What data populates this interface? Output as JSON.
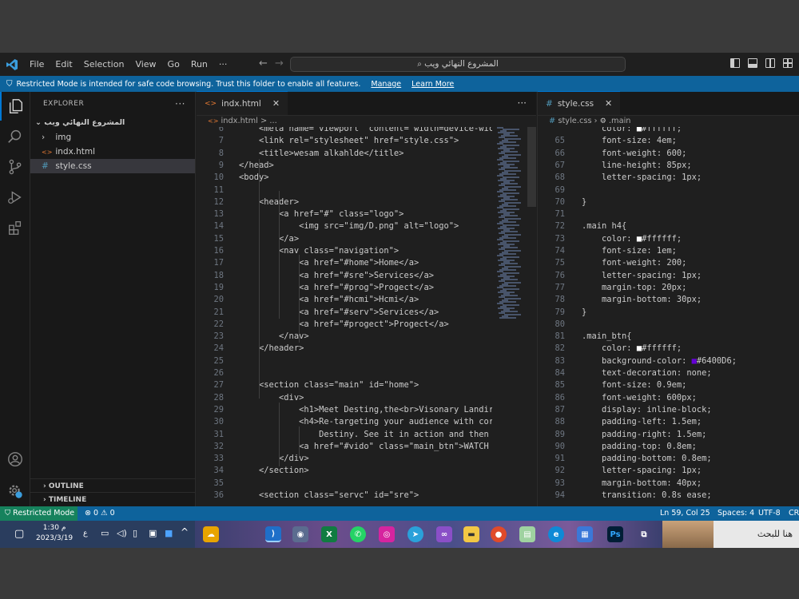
{
  "titlebar": {
    "menu": [
      "File",
      "Edit",
      "Selection",
      "View",
      "Go",
      "Run",
      "···"
    ],
    "search_text": "المشروع النهائي ويب",
    "icons": [
      "vscode-logo",
      "back-arrow",
      "forward-arrow",
      "toggle-sidebar",
      "toggle-panel",
      "toggle-secondary",
      "customize-layout"
    ]
  },
  "restricted_bar": {
    "message": "Restricted Mode is intended for safe code browsing. Trust this folder to enable all features.",
    "manage": "Manage",
    "learn_more": "Learn More"
  },
  "sidebar": {
    "title": "EXPLORER",
    "more": "···",
    "folder": "المشروع النهائي ويب",
    "items": [
      {
        "label": "img",
        "icon": ">"
      },
      {
        "label": "indx.html",
        "icon": "<>"
      },
      {
        "label": "style.css",
        "icon": "#"
      }
    ],
    "outline": "OUTLINE",
    "timeline": "TIMELINE"
  },
  "editor_left": {
    "tab_label": "indx.html",
    "tab_icon": "<>",
    "breadcrumb_file": "indx.html",
    "breadcrumb_rest": "> ...",
    "more": "···",
    "lines": [
      {
        "n": "6",
        "t": "    <meta name=\"viewport\" content=\"width=device-wic"
      },
      {
        "n": "7",
        "t": "    <link rel=\"stylesheet\" href=\"style.css\">"
      },
      {
        "n": "8",
        "t": "    <title>wesam alkahlde</title>"
      },
      {
        "n": "9",
        "t": "</head>"
      },
      {
        "n": "10",
        "t": "<body>"
      },
      {
        "n": "11",
        "t": ""
      },
      {
        "n": "12",
        "t": "    <header>"
      },
      {
        "n": "13",
        "t": "        <a href=\"#\" class=\"logo\">"
      },
      {
        "n": "14",
        "t": "            <img src=\"img/D.png\" alt=\"logo\">"
      },
      {
        "n": "15",
        "t": "        </a>"
      },
      {
        "n": "16",
        "t": "        <nav class=\"navigation\">"
      },
      {
        "n": "17",
        "t": "            <a href=\"#home\">Home</a>"
      },
      {
        "n": "18",
        "t": "            <a href=\"#sre\">Services</a>"
      },
      {
        "n": "19",
        "t": "            <a href=\"#prog\">Progect</a>"
      },
      {
        "n": "20",
        "t": "            <a href=\"#hcmi\">Hcmi</a>"
      },
      {
        "n": "21",
        "t": "            <a href=\"#serv\">Services</a>"
      },
      {
        "n": "22",
        "t": "            <a href=\"#progect\">Progect</a>"
      },
      {
        "n": "23",
        "t": "        </nav>"
      },
      {
        "n": "24",
        "t": "    </header>"
      },
      {
        "n": "25",
        "t": ""
      },
      {
        "n": "26",
        "t": ""
      },
      {
        "n": "27",
        "t": "    <section class=\"main\" id=\"home\">"
      },
      {
        "n": "28",
        "t": "        <div>"
      },
      {
        "n": "29",
        "t": "            <h1>Meet Desting,the<br>Visonary Landir"
      },
      {
        "n": "30",
        "t": "            <h4>Re-targeting your audience with cor"
      },
      {
        "n": "31",
        "t": "                Destiny. See it in action and then"
      },
      {
        "n": "32",
        "t": "            <a href=\"#vido\" class=\"main_btn\">WATCH"
      },
      {
        "n": "33",
        "t": "        </div>"
      },
      {
        "n": "34",
        "t": "    </section>"
      },
      {
        "n": "35",
        "t": ""
      },
      {
        "n": "36",
        "t": "    <section class=\"servc\" id=\"sre\">"
      }
    ]
  },
  "editor_right": {
    "tab_label": "style.css",
    "tab_icon": "#",
    "tab_close": "✕",
    "breadcrumb_file": "style.css",
    "breadcrumb_sym": ".main",
    "lines": [
      {
        "n": "",
        "t": "    color: ■#ffffff;"
      },
      {
        "n": "65",
        "t": "    font-size: 4em;"
      },
      {
        "n": "66",
        "t": "    font-weight: 600;"
      },
      {
        "n": "67",
        "t": "    line-height: 85px;"
      },
      {
        "n": "68",
        "t": "    letter-spacing: 1px;"
      },
      {
        "n": "69",
        "t": ""
      },
      {
        "n": "70",
        "t": "}"
      },
      {
        "n": "71",
        "t": ""
      },
      {
        "n": "72",
        "t": ".main h4{"
      },
      {
        "n": "73",
        "t": "    color: ■#ffffff;"
      },
      {
        "n": "74",
        "t": "    font-size: 1em;"
      },
      {
        "n": "75",
        "t": "    font-weight: 200;"
      },
      {
        "n": "76",
        "t": "    letter-spacing: 1px;"
      },
      {
        "n": "77",
        "t": "    margin-top: 20px;"
      },
      {
        "n": "78",
        "t": "    margin-bottom: 30px;"
      },
      {
        "n": "79",
        "t": "}"
      },
      {
        "n": "80",
        "t": ""
      },
      {
        "n": "81",
        "t": ".main_btn{"
      },
      {
        "n": "82",
        "t": "    color: ■#ffffff;"
      },
      {
        "n": "83",
        "t": "    background-color: ■#6400D6;"
      },
      {
        "n": "84",
        "t": "    text-decoration: none;"
      },
      {
        "n": "85",
        "t": "    font-size: 0.9em;"
      },
      {
        "n": "86",
        "t": "    font-weight: 600px;"
      },
      {
        "n": "87",
        "t": "    display: inline-block;"
      },
      {
        "n": "88",
        "t": "    padding-left: 1.5em;"
      },
      {
        "n": "89",
        "t": "    padding-right: 1.5em;"
      },
      {
        "n": "90",
        "t": "    padding-top: 0.8em;"
      },
      {
        "n": "91",
        "t": "    padding-bottom: 0.8em;"
      },
      {
        "n": "92",
        "t": "    letter-spacing: 1px;"
      },
      {
        "n": "93",
        "t": "    margin-bottom: 40px;"
      },
      {
        "n": "94",
        "t": "    transition: 0.8s ease;"
      }
    ]
  },
  "statusbar": {
    "mode": "Restricted Mode",
    "problems": "⊗ 0 ⚠ 0",
    "cursor": "Ln 59, Col 25",
    "spaces": "Spaces: 4",
    "encoding": "UTF-8",
    "eol": "CR"
  },
  "taskbar": {
    "time": "1:30 م",
    "date": "2023/3/19",
    "lang": "ع",
    "search_text": "هنا للبحث",
    "icons": [
      "chat-icon",
      "network-icon",
      "volume-icon",
      "battery-icon",
      "widgets-icon",
      "chevron-up-icon"
    ]
  },
  "colors": {
    "accent": "#0e639c",
    "restricted_status": "#16825d",
    "swatch_purple": "#6400D6",
    "swatch_white": "#ffffff"
  }
}
